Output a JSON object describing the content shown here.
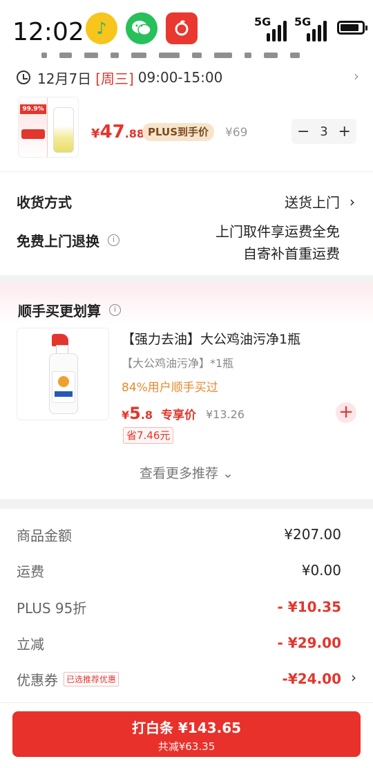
{
  "status_bar": {
    "time": "12:02",
    "net1": "5G",
    "net2": "5G",
    "icons": [
      "qq-music-icon",
      "wechat-icon",
      "netease-music-icon",
      "signal-icon",
      "battery-icon"
    ]
  },
  "product": {
    "delivery_date": "12月7日",
    "delivery_week": "[周三]",
    "delivery_time": "09:00-15:00",
    "price_yen": "¥",
    "price_int": "47",
    "price_dec": ".88",
    "plus_badge": "PLUS到手价",
    "orig_price": "¥69",
    "quantity": "3",
    "thumb_label": "99.9%"
  },
  "shipping": {
    "method_label": "收货方式",
    "method_value": "送货上门",
    "return_label": "免费上门退换",
    "return_line1": "上门取件享运费全免",
    "return_line2": "自寄补首重运费"
  },
  "addon": {
    "title": "顺手买更划算",
    "name": "【强力去油】大公鸡油污净1瓶",
    "sub": "【大公鸡油污净】*1瓶",
    "social": "84%用户顺手买过",
    "price_yen": "¥",
    "price_int": "5",
    "price_dec": ".8",
    "price_tag": "专享价",
    "orig_price": "¥13.26",
    "save": "省7.46元",
    "more": "查看更多推荐 ⌄"
  },
  "summary": {
    "rows": [
      {
        "label": "商品金额",
        "value": "¥207.00"
      },
      {
        "label": "运费",
        "value": "¥0.00"
      },
      {
        "label": "PLUS 95折",
        "value": "- ¥10.35"
      },
      {
        "label": "立减",
        "value": "- ¥29.00"
      },
      {
        "label": "优惠券",
        "value": "-¥24.00",
        "badge": "已选推荐优惠"
      }
    ]
  },
  "pay": {
    "main": "打白条 ¥143.65",
    "sub": "共减¥63.35"
  },
  "colors": {
    "accent": "#e3362c",
    "pay_button": "#e8312b",
    "plus_badge_bg": "#f8e4cc",
    "social_orange": "#e8892d"
  }
}
